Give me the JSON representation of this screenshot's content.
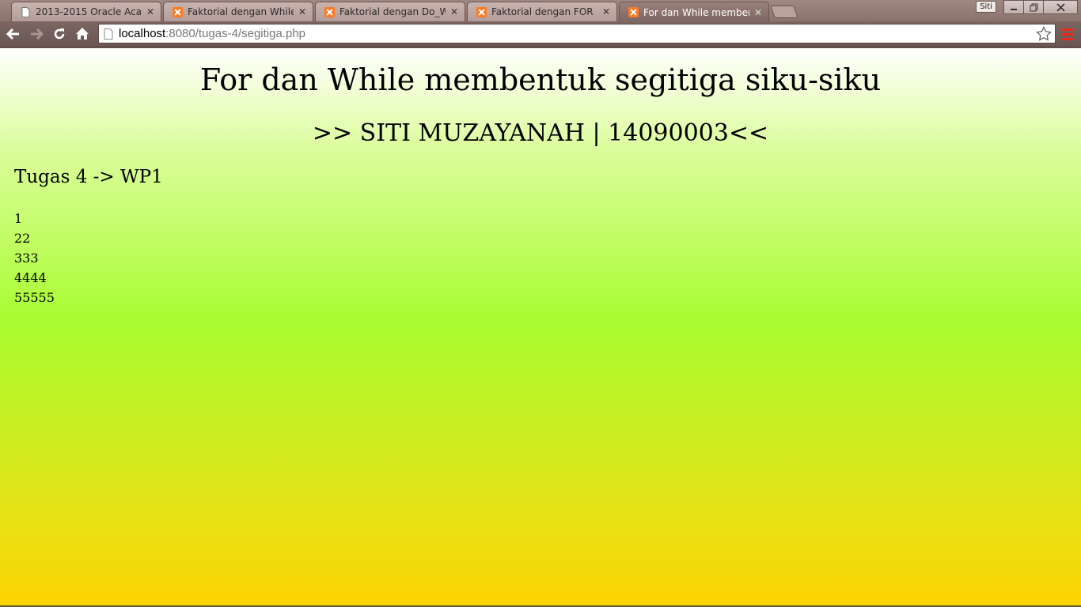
{
  "tabs": [
    {
      "title": "2013-2015 Oracle Academ",
      "icon": "page-icon",
      "active": false
    },
    {
      "title": "Faktorial dengan While",
      "icon": "xampp-icon",
      "active": false
    },
    {
      "title": "Faktorial dengan Do_Whil",
      "icon": "xampp-icon",
      "active": false
    },
    {
      "title": "Faktorial dengan FOR",
      "icon": "xampp-icon",
      "active": false
    },
    {
      "title": "For dan While membentuk",
      "icon": "xampp-icon",
      "active": true
    }
  ],
  "window": {
    "profile_label": "Siti"
  },
  "address_bar": {
    "host": "localhost",
    "rest": ":8080/tugas-4/segitiga.php"
  },
  "page": {
    "title": "For dan While membentuk segitiga siku-siku",
    "author": ">> SITI MUZAYANAH | 14090003<<",
    "task": "Tugas 4 -> WP1",
    "triangle_lines": [
      "1",
      "22",
      "333",
      "4444",
      "55555"
    ]
  },
  "colors": {
    "gradient_top": "#ffffff",
    "gradient_mid": "#a8fd30",
    "gradient_bottom": "#fdd300",
    "tab_active": "#8a716c",
    "xampp_orange": "#fb7a24"
  }
}
